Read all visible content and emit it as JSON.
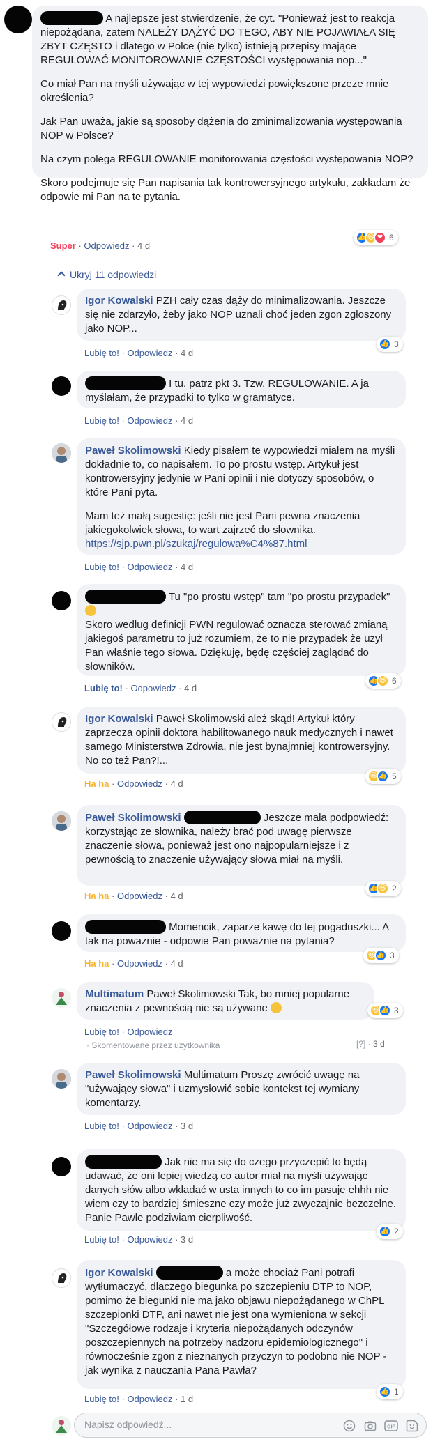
{
  "thread": {
    "main": {
      "text": [
        " A najlepsze jest stwierdzenie, że cyt. \"Ponieważ jest to reakcja niepożądana, zatem NALEŻY DĄŻYĆ DO TEGO, ABY NIE POJAWIAŁA SIĘ ZBYT CZĘSTO i dlatego w Polce (nie tylko) istnieją przepisy mające REGULOWAĆ MONITOROWANIE CZĘSTOŚCI występowania nop...\"",
        "Co miał Pan na myśli używając w tej wypowiedzi powiększone przeze mnie określenia?",
        "Jak Pan uważa, jakie są sposoby dążenia do zminimalizowania występowania NOP w Polsce?",
        "Na czym polega REGULOWANIE monitorowania częstości występowania NOP?",
        "Skoro podejmuje się Pan napisania tak kontrowersyjnego artykułu, zakładam że odpowie mi Pan na te pytania."
      ],
      "reaction_label": "Super",
      "reply_label": "Odpowiedz",
      "time": "4 d",
      "reaction_count": "6"
    },
    "hide_replies": "Ukryj 11 odpowiedzi",
    "replies": [
      {
        "author": "Igor Kowalski",
        "text": " PZH cały czas dąży do minimalizowania. Jeszcze się nie zdarzyło, żeby jako NOP uznali choć jeden zgon zgłoszony jako NOP...",
        "like": "Lubię to!",
        "reply": "Odpowiedz",
        "time": "4 d",
        "count": "3"
      },
      {
        "text": " I tu. patrz pkt 3. Tzw. REGULOWANIE. A ja myślałam, że przypadki to tylko w gramatyce.",
        "like": "Lubię to!",
        "reply": "Odpowiedz",
        "time": "4 d"
      },
      {
        "author": "Paweł Skolimowski",
        "text": " Kiedy pisałem te wypowiedzi miałem na myśli dokładnie to, co napisałem. To po prostu wstęp. Artykuł jest kontrowersyjny jedynie w Pani opinii i nie dotyczy sposobów, o które Pani pyta.",
        "text2": "Mam też małą sugestię: jeśli nie jest Pani pewna znaczenia jakiegokolwiek słowa, to wart zajrzeć do słownika.",
        "url": "https://sjp.pwn.pl/szukaj/regulowa%C4%87.html",
        "like": "Lubię to!",
        "reply": "Odpowiedz",
        "time": "4 d"
      },
      {
        "text_a": " Tu \"po prostu wstęp\" tam \"po prostu przypadek\" ",
        "text_b": "Skoro według definicji PWN regulować oznacza sterować zmianą jakiegoś parametru to już rozumiem, że to nie przypadek że uzył Pan właśnie tego słowa. Dziękuję, będę częściej zaglądać do słowników.",
        "like": "Lubię to!",
        "reply": "Odpowiedz",
        "time": "4 d",
        "count": "6"
      },
      {
        "author": "Igor Kowalski",
        "text": " Paweł Skolimowski ależ skąd! Artykuł który zaprzecza opinii doktora habilitowanego nauk medycznych i nawet samego Ministerstwa Zdrowia, nie jest bynajmniej kontrowersyjny. No co też Pan?!...",
        "like": "Ha ha",
        "reply": "Odpowiedz",
        "time": "4 d",
        "count": "5"
      },
      {
        "author": "Paweł Skolimowski",
        "text": " Jeszcze mała podpowiedź: korzystając ze słownika, należy brać pod uwagę pierwsze znaczenie słowa, ponieważ jest ono najpopularniejsze i z pewnością to znaczenie używający słowa miał na myśli.",
        "like": "Ha ha",
        "reply": "Odpowiedz",
        "time": "4 d",
        "count": "2"
      },
      {
        "text": " Momencik, zaparze kawę do tej pogaduszki... A tak na poważnie - odpowie Pan poważnie na pytania?",
        "like": "Ha ha",
        "reply": "Odpowiedz",
        "time": "4 d",
        "count": "3"
      },
      {
        "author": "Multimatum",
        "text": " Paweł Skolimowski Tak, bo mniej popularne znaczenia z pewnością nie są używane ",
        "like": "Lubię to!",
        "reply": "Odpowiedz",
        "by_user": "· Skomentowane przez użytkownika",
        "q": "[?] ·",
        "time": "3 d",
        "count": "3"
      },
      {
        "author": "Paweł Skolimowski",
        "text": " Multimatum Proszę zwrócić uwagę na \"używający słowa\" i uzmysłowić sobie kontekst tej wymiany komentarzy.",
        "like": "Lubię to!",
        "reply": "Odpowiedz",
        "time": "3 d"
      },
      {
        "text": " Jak nie ma się do czego przyczepić to będą udawać, że oni lepiej wiedzą co autor miał na myśli używając danych słów albo wkładać w usta innych to co im pasuje ehhh nie wiem czy to bardziej śmieszne czy może już zwyczajnie bezczelne. Panie Pawle podziwiam cierpliwość.",
        "like": "Lubię to!",
        "reply": "Odpowiedz",
        "time": "3 d",
        "count": "2"
      },
      {
        "author": "Igor Kowalski",
        "text": " a może chociaż Pani potrafi wytłumaczyć, dlaczego biegunka po szczepieniu DTP to NOP, pomimo że biegunki nie ma jako objawu niepożądanego w ChPL szczepionki DTP, ani nawet nie jest ona wymieniona w sekcji \"Szczegółowe rodzaje i kryteria niepożądanych odczynów poszczepiennych na potrzeby nadzoru epidemiologicznego\" i równocześnie zgon z nieznanych przyczyn to podobno nie NOP - jak wynika z nauczania Pana Pawła?",
        "like": "Lubię to!",
        "reply": "Odpowiedz",
        "time": "1 d",
        "count": "1"
      }
    ]
  },
  "composer": {
    "placeholder": "Napisz odpowiedź..."
  },
  "colors": {
    "link": "#385898",
    "bubble": "#f0f2f5",
    "super": "#f33e58",
    "haha": "#f7b125",
    "like": "#1877f2"
  },
  "icons": [
    "emoji-icon",
    "camera-icon",
    "gif-icon",
    "sticker-icon"
  ]
}
